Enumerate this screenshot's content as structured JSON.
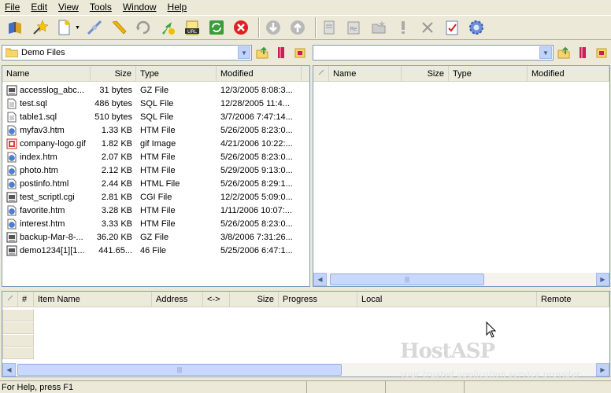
{
  "menu": [
    "File",
    "Edit",
    "View",
    "Tools",
    "Window",
    "Help"
  ],
  "toolbar": {
    "buttons": [
      "connect-book-icon",
      "wizard-icon",
      "new-document-icon",
      "disconnect-plug-icon",
      "pencil-edit-icon",
      "reconnect-icon",
      "upload-site-icon",
      "url-icon",
      "refresh-icon",
      "stop-icon",
      "download-arrow-icon",
      "upload-arrow-icon",
      "properties-icon",
      "rename-icon",
      "new-folder-icon",
      "exclamation-icon",
      "delete-icon",
      "checklist-icon",
      "settings-gear-icon"
    ]
  },
  "left_pane": {
    "path": "Demo Files",
    "columns": [
      "Name",
      "Size",
      "Type",
      "Modified"
    ],
    "files": [
      {
        "name": "accesslog_abc...",
        "size": "31 bytes",
        "type": "GZ File",
        "modified": "12/3/2005 8:08:3...",
        "icon": "archive"
      },
      {
        "name": "test.sql",
        "size": "486 bytes",
        "type": "SQL File",
        "modified": "12/28/2005 11:4...",
        "icon": "doc"
      },
      {
        "name": "table1.sql",
        "size": "510 bytes",
        "type": "SQL File",
        "modified": "3/7/2006 7:47:14...",
        "icon": "doc"
      },
      {
        "name": "myfav3.htm",
        "size": "1.33 KB",
        "type": "HTM File",
        "modified": "5/26/2005 8:23:0...",
        "icon": "web"
      },
      {
        "name": "company-logo.gif",
        "size": "1.82 KB",
        "type": "gif Image",
        "modified": "4/21/2006 10:22:...",
        "icon": "image"
      },
      {
        "name": "index.htm",
        "size": "2.07 KB",
        "type": "HTM File",
        "modified": "5/26/2005 8:23:0...",
        "icon": "web"
      },
      {
        "name": "photo.htm",
        "size": "2.12 KB",
        "type": "HTM File",
        "modified": "5/29/2005 9:13:0...",
        "icon": "web"
      },
      {
        "name": "postinfo.html",
        "size": "2.44 KB",
        "type": "HTML File",
        "modified": "5/26/2005 8:29:1...",
        "icon": "web"
      },
      {
        "name": "test_scriptl.cgi",
        "size": "2.81 KB",
        "type": "CGI File",
        "modified": "12/2/2005 5:09:0...",
        "icon": "archive"
      },
      {
        "name": "favorite.htm",
        "size": "3.28 KB",
        "type": "HTM File",
        "modified": "1/11/2006 10:07:...",
        "icon": "web"
      },
      {
        "name": "interest.htm",
        "size": "3.33 KB",
        "type": "HTM File",
        "modified": "5/26/2005 8:23:0...",
        "icon": "web"
      },
      {
        "name": "backup-Mar-8-...",
        "size": "36.20 KB",
        "type": "GZ File",
        "modified": "3/8/2006 7:31:26...",
        "icon": "archive"
      },
      {
        "name": "demo1234[1][1...",
        "size": "441.65...",
        "type": "46 File",
        "modified": "5/25/2006 6:47:1...",
        "icon": "archive"
      }
    ]
  },
  "right_pane": {
    "path": "",
    "columns": [
      "Name",
      "Size",
      "Type",
      "Modified"
    ],
    "scroll_thumb": "|||"
  },
  "queue": {
    "columns": [
      "#",
      "Item Name",
      "Address",
      "<->",
      "Size",
      "Progress",
      "Local",
      "Remote"
    ],
    "scroll_thumb": "|||"
  },
  "watermark": {
    "brand": "HostASP",
    "tagline": "your trusted application service provider"
  },
  "status": "For Help, press F1"
}
